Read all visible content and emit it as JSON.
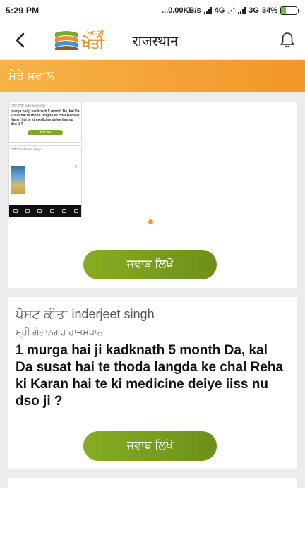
{
  "status_bar": {
    "time": "5:29 PM",
    "network_info": "...0.00KB/s",
    "network_type_1": "4G",
    "network_type_2": "3G",
    "battery": "34%",
    "battery_level": 0.34
  },
  "app_bar": {
    "logo_small": "ਆਪਣੀ",
    "logo_big": "ਖੇਤੀ",
    "state_title": "राजस्थान"
  },
  "section": {
    "title": "ਮੇਰੇ ਸਵਾਲ"
  },
  "cards": [
    {
      "thumb_top_header": "ਪੋਸਟ ਕੀਤਾ inderjeet singh",
      "thumb_top_text": "murga hai ji kadknath 5 month Da, kal Da susat hai te thoda langda ke chal Reha ki Karan hai te ki medicine deiye iiss nu dso ji ?",
      "thumb_top_btn": "ਜਵਾਬ ਲਿਖੋ",
      "thumb_bottom_name": "ਟ ਕੀਤਾ inderjeet singh",
      "thumb_bottom_count": "(1)",
      "reply_label": "ਜਵਾਬ ਲਿਖੋ"
    },
    {
      "posted_by": "ਪੋਸਟ ਕੀਤਾ inderjeet singh",
      "location": "ਸ਼੍ਰੀ ਗੰਗਾਨਗਰ ਰਾਜਸਥਾਨ",
      "question": "1 murga hai ji kadknath 5 month Da, kal Da susat hai te thoda langda ke chal Reha ki Karan hai te ki medicine deiye iiss nu  dso ji  ?",
      "reply_label": "ਜਵਾਬ ਲਿਖੋ"
    }
  ],
  "colors": {
    "header_orange": "#f2962a",
    "button_green": "#7ea825",
    "dot_orange": "#f39c24"
  }
}
